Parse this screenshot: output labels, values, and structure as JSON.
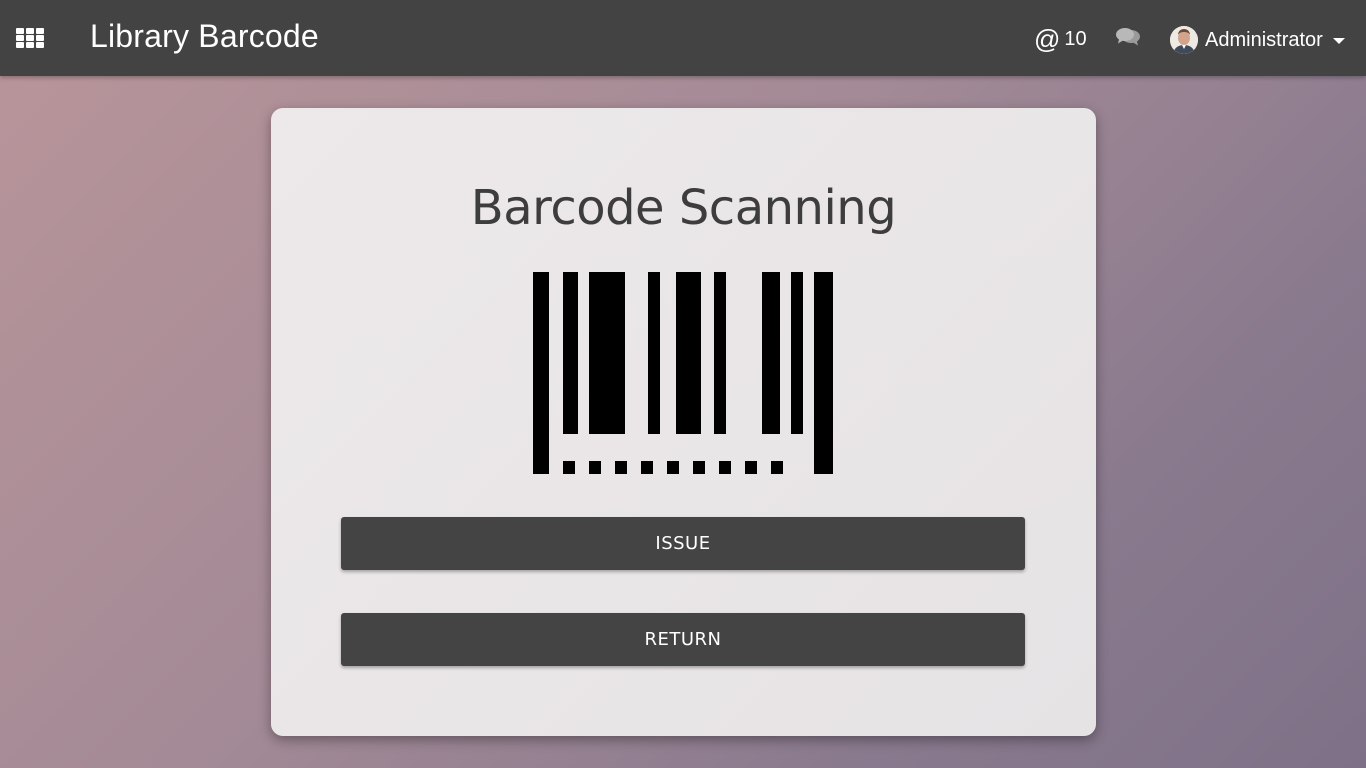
{
  "navbar": {
    "apps_icon": "grid-icon",
    "app_title": "Library Barcode",
    "mentions": {
      "icon": "at-icon",
      "symbol": "@",
      "count": "10"
    },
    "chat_icon": "chat-bubbles-icon",
    "user": {
      "name": "Administrator",
      "avatar_icon": "avatar",
      "caret_icon": "caret-down-icon"
    },
    "bg_color": "#434343"
  },
  "card": {
    "title": "Barcode Scanning",
    "barcode_icon": "barcode-icon",
    "buttons": {
      "issue": "ISSUE",
      "return": "RETURN"
    },
    "button_color": "#444444"
  }
}
